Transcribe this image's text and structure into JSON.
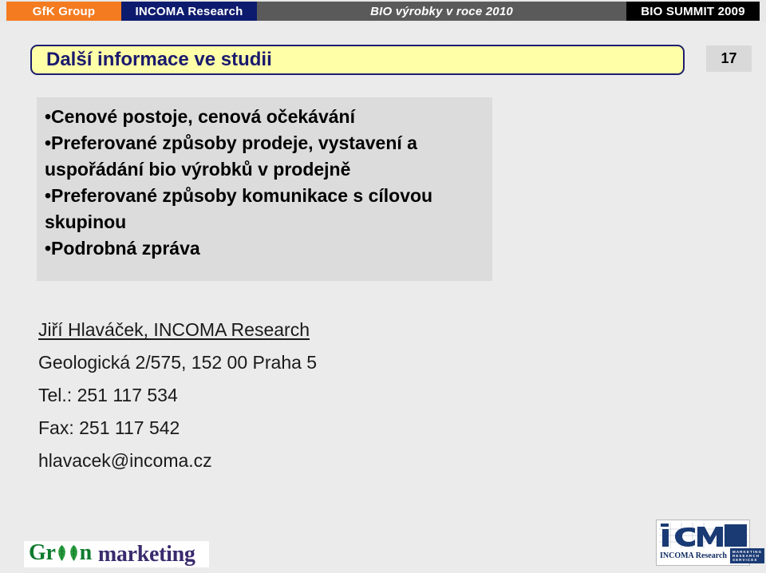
{
  "header": {
    "brand_left": "GfK Group",
    "brand_second": "INCOMA  Research",
    "topic": "BIO výrobky v roce 2010",
    "event": "BIO SUMMIT 2009",
    "colors": {
      "brand_left_bg": "#f47b20",
      "brand_second_bg": "#0d1b6e",
      "topic_bg": "#5a5a5a",
      "event_bg": "#000000"
    }
  },
  "title": {
    "text": "Další informace ve studii",
    "border_color": "#1d1d6e",
    "background_color": "#ffffa8",
    "text_color": "#1a1a6e"
  },
  "page_number": "17",
  "bullets": {
    "background_color": "#dcdcdc",
    "items": [
      "•Cenové postoje, cenová očekávání",
      "•Preferované způsoby prodeje, vystavení a uspořádání bio výrobků v prodejně",
      "•Preferované způsoby komunikace s cílovou skupinou",
      "•Podrobná zpráva"
    ]
  },
  "contact": {
    "name_org": "Jiří Hlaváček, INCOMA Research",
    "address": "Geologická 2/575, 152 00 Praha 5",
    "phone": "Tel.: 251 117 534",
    "fax": "Fax: 251 117 542",
    "email": "hlavacek@incoma.cz"
  },
  "footer": {
    "green_logo": {
      "word_one_prefix": "Gr",
      "word_one_suffix": "n",
      "word_two": "marketing",
      "green_color": "#0e7a2e",
      "purple_color": "#3a2a6e"
    },
    "incoma_logo": {
      "mark": "iCM",
      "name": "INCOMA Research",
      "tagline_line1": "MARKETING",
      "tagline_line2": "RESEARCH",
      "tagline_line3": "SERVICES",
      "navy": "#1a3a74"
    }
  }
}
